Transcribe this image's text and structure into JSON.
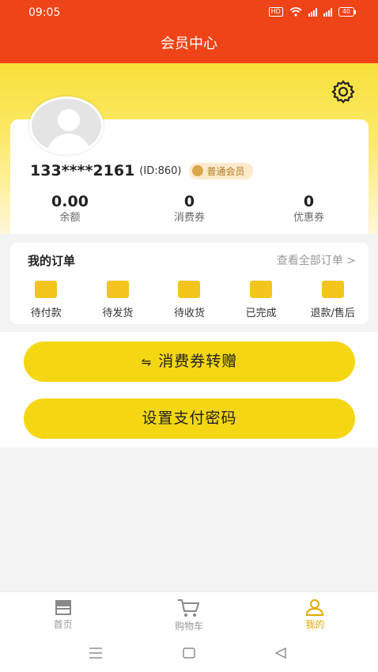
{
  "status": {
    "time": "09:05",
    "hd": "HD",
    "battery": "40"
  },
  "header": {
    "title": "会员中心"
  },
  "profile": {
    "phone": "133****2161",
    "id": "(ID:860)",
    "level": "普通会员",
    "stats": [
      {
        "value": "0.00",
        "label": "余额"
      },
      {
        "value": "0",
        "label": "消费券"
      },
      {
        "value": "0",
        "label": "优惠券"
      }
    ]
  },
  "orders": {
    "title": "我的订单",
    "view_all": "查看全部订单 >",
    "items": [
      {
        "label": "待付款",
        "icon": "wallet-icon"
      },
      {
        "label": "待发货",
        "icon": "package-icon"
      },
      {
        "label": "待收货",
        "icon": "truck-icon"
      },
      {
        "label": "已完成",
        "icon": "clipboard-check-icon"
      },
      {
        "label": "退款/售后",
        "icon": "refund-icon"
      }
    ]
  },
  "actions": {
    "transfer_icon": "⇋",
    "transfer_label": "消费券转赠",
    "set_password_label": "设置支付密码"
  },
  "tabbar": {
    "items": [
      {
        "label": "首页",
        "icon": "store-icon"
      },
      {
        "label": "购物车",
        "icon": "cart-icon"
      },
      {
        "label": "我的",
        "icon": "user-icon"
      }
    ],
    "active_color": "#e3a900"
  },
  "colors": {
    "brand": "#ef4318",
    "accent": "#f5d613"
  }
}
